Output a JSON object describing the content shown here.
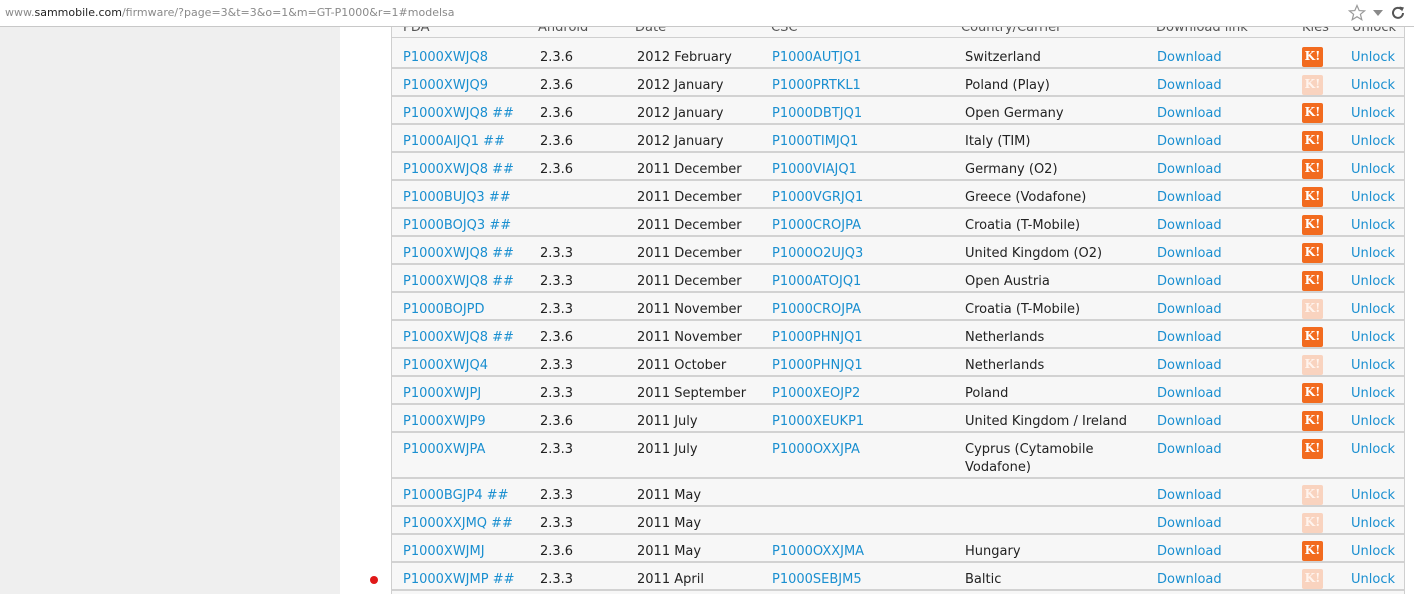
{
  "address_bar": {
    "url_prefix": "www.",
    "url_host": "sammobile.com",
    "url_path": "/firmware/?page=3&t=3&o=1&m=GT-P1000&r=1#modelsa",
    "icons": [
      "star-icon",
      "dropdown-arrow-icon",
      "reload-icon"
    ]
  },
  "table": {
    "headers": [
      "PDA",
      "Android",
      "Date",
      "CSC",
      "Country/Carrier",
      "Download link",
      "Kies",
      "Unlock"
    ],
    "kies_glyph": "K!",
    "rows": [
      {
        "pda": "P1000XWJQ8",
        "android": "2.3.6",
        "date": "2012 February",
        "csc": "P1000AUTJQ1",
        "country": "Switzerland",
        "download": "Download",
        "kies": "active",
        "unlock": "Unlock"
      },
      {
        "pda": "P1000XWJQ9",
        "android": "2.3.6",
        "date": "2012 January",
        "csc": "P1000PRTKL1",
        "country": "Poland (Play)",
        "download": "Download",
        "kies": "faded",
        "unlock": "Unlock"
      },
      {
        "pda": "P1000XWJQ8 ##",
        "android": "2.3.6",
        "date": "2012 January",
        "csc": "P1000DBTJQ1",
        "country": "Open Germany",
        "download": "Download",
        "kies": "active",
        "unlock": "Unlock"
      },
      {
        "pda": "P1000AIJQ1 ##",
        "android": "2.3.6",
        "date": "2012 January",
        "csc": "P1000TIMJQ1",
        "country": "Italy (TIM)",
        "download": "Download",
        "kies": "active",
        "unlock": "Unlock"
      },
      {
        "pda": "P1000XWJQ8 ##",
        "android": "2.3.6",
        "date": "2011 December",
        "csc": "P1000VIAJQ1",
        "country": "Germany (O2)",
        "download": "Download",
        "kies": "active",
        "unlock": "Unlock"
      },
      {
        "pda": "P1000BUJQ3 ##",
        "android": "",
        "date": "2011 December",
        "csc": "P1000VGRJQ1",
        "country": "Greece (Vodafone)",
        "download": "Download",
        "kies": "active",
        "unlock": "Unlock"
      },
      {
        "pda": "P1000BOJQ3 ##",
        "android": "",
        "date": "2011 December",
        "csc": "P1000CROJPA",
        "country": "Croatia (T-Mobile)",
        "download": "Download",
        "kies": "active",
        "unlock": "Unlock"
      },
      {
        "pda": "P1000XWJQ8 ##",
        "android": "2.3.3",
        "date": "2011 December",
        "csc": "P1000O2UJQ3",
        "country": "United Kingdom (O2)",
        "download": "Download",
        "kies": "active",
        "unlock": "Unlock"
      },
      {
        "pda": "P1000XWJQ8 ##",
        "android": "2.3.3",
        "date": "2011 December",
        "csc": "P1000ATOJQ1",
        "country": "Open Austria",
        "download": "Download",
        "kies": "active",
        "unlock": "Unlock"
      },
      {
        "pda": "P1000BOJPD",
        "android": "2.3.3",
        "date": "2011 November",
        "csc": "P1000CROJPA",
        "country": "Croatia (T-Mobile)",
        "download": "Download",
        "kies": "faded",
        "unlock": "Unlock"
      },
      {
        "pda": "P1000XWJQ8 ##",
        "android": "2.3.6",
        "date": "2011 November",
        "csc": "P1000PHNJQ1",
        "country": "Netherlands",
        "download": "Download",
        "kies": "active",
        "unlock": "Unlock"
      },
      {
        "pda": "P1000XWJQ4",
        "android": "2.3.3",
        "date": "2011 October",
        "csc": "P1000PHNJQ1",
        "country": "Netherlands",
        "download": "Download",
        "kies": "faded",
        "unlock": "Unlock"
      },
      {
        "pda": "P1000XWJPJ",
        "android": "2.3.3",
        "date": "2011 September",
        "csc": "P1000XEOJP2",
        "country": "Poland",
        "download": "Download",
        "kies": "active",
        "unlock": "Unlock"
      },
      {
        "pda": "P1000XWJP9",
        "android": "2.3.6",
        "date": "2011 July",
        "csc": "P1000XEUKP1",
        "country": "United Kingdom / Ireland",
        "download": "Download",
        "kies": "active",
        "unlock": "Unlock"
      },
      {
        "pda": "P1000XWJPA",
        "android": "2.3.3",
        "date": "2011 July",
        "csc": "P1000OXXJPA",
        "country": "Cyprus (Cytamobile Vodafone)",
        "download": "Download",
        "kies": "active",
        "unlock": "Unlock"
      },
      {
        "pda": "P1000BGJP4 ##",
        "android": "2.3.3",
        "date": "2011 May",
        "csc": "",
        "country": "",
        "download": "Download",
        "kies": "faded",
        "unlock": "Unlock"
      },
      {
        "pda": "P1000XXJMQ ##",
        "android": "2.3.3",
        "date": "2011 May",
        "csc": "",
        "country": "",
        "download": "Download",
        "kies": "faded",
        "unlock": "Unlock"
      },
      {
        "pda": "P1000XWJMJ",
        "android": "2.3.6",
        "date": "2011 May",
        "csc": "P1000OXXJMA",
        "country": "Hungary",
        "download": "Download",
        "kies": "active",
        "unlock": "Unlock"
      },
      {
        "pda": "P1000XWJMP ##",
        "android": "2.3.3",
        "date": "2011 April",
        "csc": "P1000SEBJM5",
        "country": "Baltic",
        "download": "Download",
        "kies": "faded",
        "unlock": "Unlock"
      }
    ]
  },
  "colors": {
    "link": "#1a8fd0",
    "kies_active": "#f26b1f",
    "kies_faded": "#f9d3bf",
    "marker": "#e01818"
  }
}
